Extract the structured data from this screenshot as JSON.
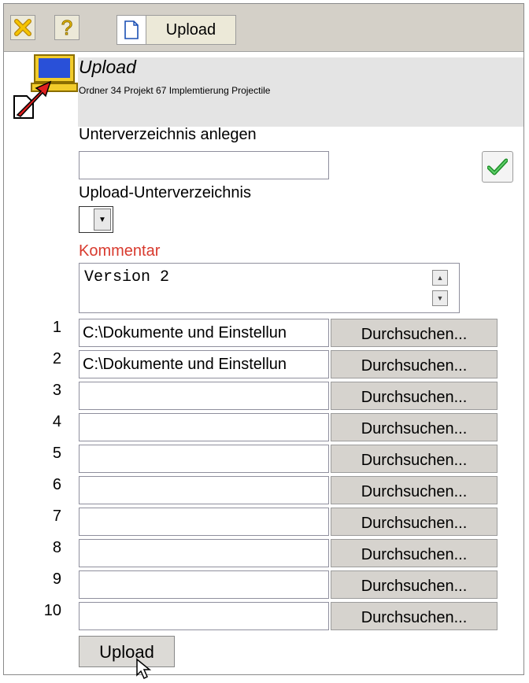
{
  "toolbar": {
    "close_icon": "close-x-icon",
    "help_icon": "help-question-icon",
    "upload_label": "Upload"
  },
  "header": {
    "title": "Upload",
    "subtitle": "Ordner 34 Projekt 67 Implemtierung Projectile"
  },
  "form": {
    "subdir_label": "Unterverzeichnis anlegen",
    "subdir_value": "",
    "upload_subdir_label": "Upload-Unterverzeichnis",
    "upload_subdir_value": "",
    "comment_label": "Kommentar",
    "comment_value": "Version 2",
    "browse_label": "Durchsuchen...",
    "submit_label": "Upload",
    "colors": {
      "comment_label": "#d83a2e",
      "toolbar_bg": "#d4d0c8"
    }
  },
  "files": [
    {
      "num": "1",
      "value": "C:\\Dokumente und Einstellun"
    },
    {
      "num": "2",
      "value": "C:\\Dokumente und Einstellun"
    },
    {
      "num": "3",
      "value": ""
    },
    {
      "num": "4",
      "value": ""
    },
    {
      "num": "5",
      "value": ""
    },
    {
      "num": "6",
      "value": ""
    },
    {
      "num": "7",
      "value": ""
    },
    {
      "num": "8",
      "value": ""
    },
    {
      "num": "9",
      "value": ""
    },
    {
      "num": "10",
      "value": ""
    }
  ]
}
